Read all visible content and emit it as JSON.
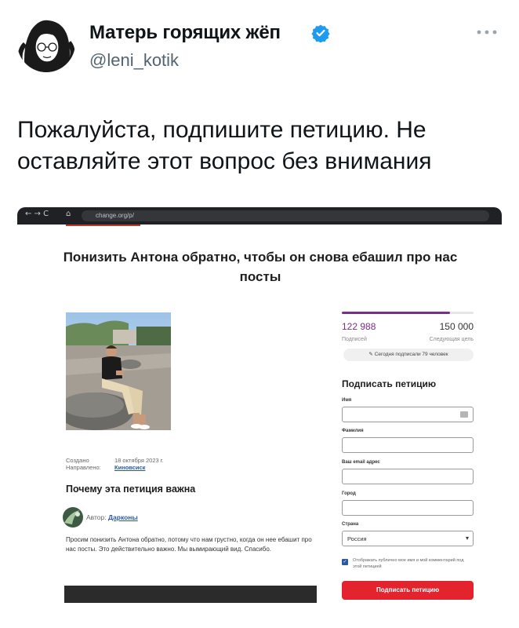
{
  "tweet": {
    "display_name": "Матерь горящих жёп",
    "handle": "@leni_kotik",
    "text": "Пожалуйста, подпишите петицию. Не оставляйте этот вопрос без внимания"
  },
  "browser": {
    "nav": "← → C",
    "url": "change.org/p/"
  },
  "petition": {
    "title": "Понизить Антона обратно, чтобы он снова ебашил про нас посты",
    "created_label": "Создано",
    "created_value": "18 октября 2023 г.",
    "addressed_label": "Направлено:",
    "addressed_value": "Киновсиск",
    "why_heading": "Почему эта петиция важна",
    "author_prefix": "Автор:",
    "author_name": "Дарконы",
    "body": "Просим понизить Антона обратно, потому что нам грустно, когда он нее ебашит про нас посты. Это действительно важно. Мы вымирающий вид. Спасибо."
  },
  "signatures": {
    "count": "122 988",
    "count_label": "Подписей",
    "goal": "150 000",
    "goal_label": "Следующая цель",
    "progress": 0.82,
    "today": "Сегодня подписали 79 человек"
  },
  "form": {
    "heading": "Подписать петицию",
    "first_name_label": "Имя",
    "last_name_label": "Фамилия",
    "email_label": "Ваш email адрес",
    "city_label": "Город",
    "country_label": "Страна",
    "country_value": "Россия",
    "checkbox_label": "Отображать публично мое имя и мой комментарий под этой петицией",
    "submit_label": "Подписать петицию"
  },
  "colors": {
    "accent_purple": "#7b2d8b",
    "verified_blue": "#1d9bf0",
    "button_red": "#e3232d"
  }
}
